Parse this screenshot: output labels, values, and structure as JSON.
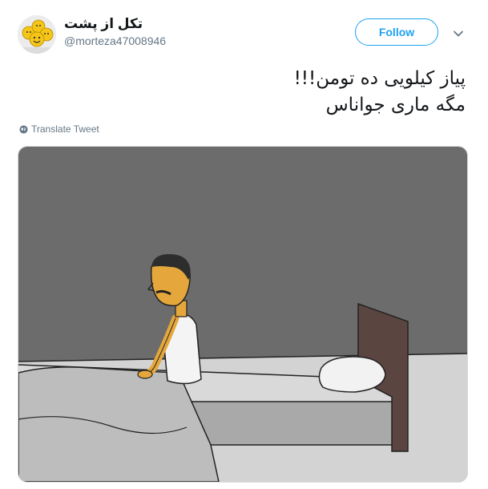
{
  "tweet": {
    "author_name": "تکل از پشت",
    "handle": "@morteza47008946",
    "follow_label": "Follow",
    "text_lines": [
      "پیاز کیلویی ده تومن!!!",
      "مگه ماری جواناس"
    ],
    "translate_label": "Translate Tweet"
  },
  "icons": {
    "caret": "chevron-down-icon",
    "globe": "globe-icon"
  },
  "colors": {
    "accent": "#1da1f2",
    "text": "#14171a",
    "secondary": "#657786",
    "wall": "#6c6c6c",
    "floor": "#d3d3d3",
    "headboard": "#5b4540",
    "skin": "#e5a73c"
  }
}
